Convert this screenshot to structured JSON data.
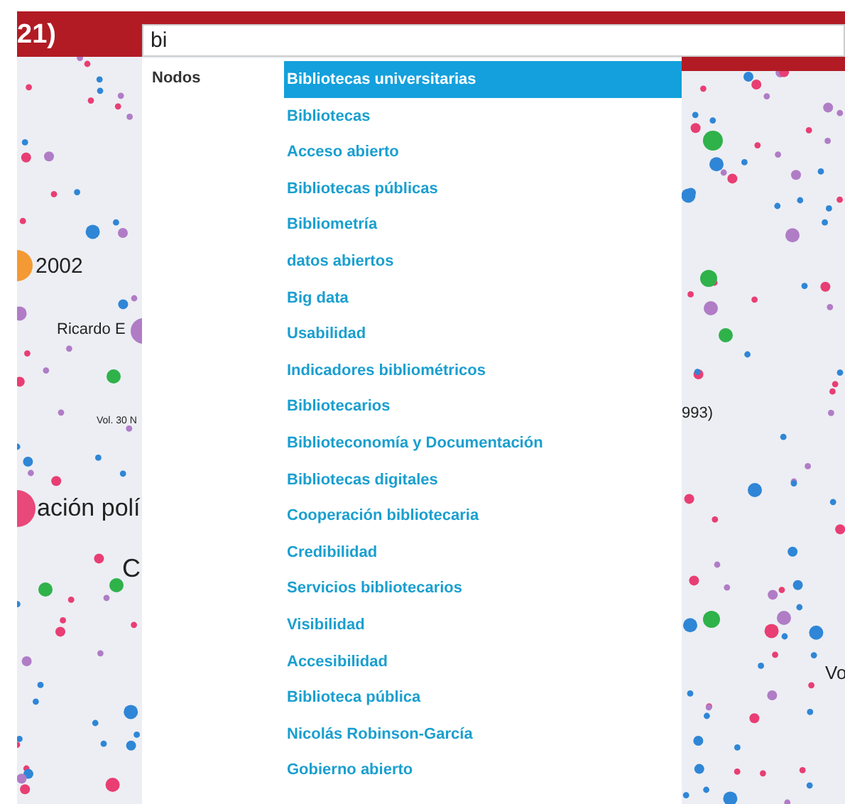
{
  "header": {
    "title": "21)"
  },
  "search": {
    "value": "bi"
  },
  "graph": {
    "labels": [
      "2002",
      "Ricardo E",
      "Vol. 30 N",
      "ación polí",
      "C",
      "993)",
      "Vo"
    ]
  },
  "dropdown": {
    "section": "Nodos",
    "items": [
      {
        "label": "Bibliotecas universitarias",
        "selected": true
      },
      {
        "label": "Bibliotecas",
        "selected": false
      },
      {
        "label": "Acceso abierto",
        "selected": false
      },
      {
        "label": "Bibliotecas públicas",
        "selected": false
      },
      {
        "label": "Bibliometría",
        "selected": false
      },
      {
        "label": "datos abiertos",
        "selected": false
      },
      {
        "label": "Big data",
        "selected": false
      },
      {
        "label": "Usabilidad",
        "selected": false
      },
      {
        "label": "Indicadores bibliométricos",
        "selected": false
      },
      {
        "label": "Bibliotecarios",
        "selected": false
      },
      {
        "label": "Biblioteconomía y Documentación",
        "selected": false
      },
      {
        "label": "Bibliotecas digitales",
        "selected": false
      },
      {
        "label": "Cooperación bibliotecaria",
        "selected": false
      },
      {
        "label": "Credibilidad",
        "selected": false
      },
      {
        "label": "Servicios bibliotecarios",
        "selected": false
      },
      {
        "label": "Visibilidad",
        "selected": false
      },
      {
        "label": "Accesibilidad",
        "selected": false
      },
      {
        "label": "Biblioteca pública",
        "selected": false
      },
      {
        "label": "Nicolás Robinson-García",
        "selected": false
      },
      {
        "label": "Gobierno abierto",
        "selected": false
      }
    ]
  }
}
